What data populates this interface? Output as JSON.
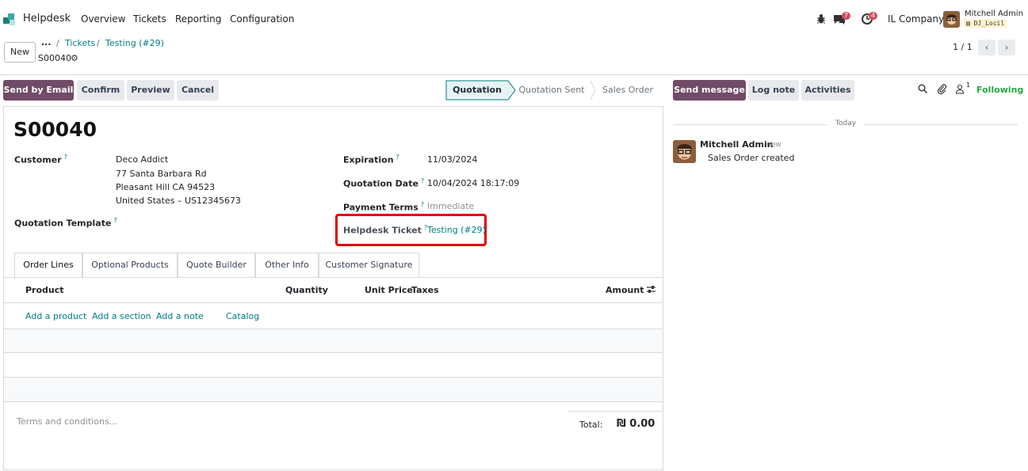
{
  "navbar": {
    "app_name": "Helpdesk",
    "menus": [
      "Overview",
      "Tickets",
      "Reporting",
      "Configuration"
    ],
    "messages_count": "7",
    "activities_count": "4",
    "company": "IL Company",
    "user_name": "Mitchell Admin",
    "database": "DJ_Locil"
  },
  "control_panel": {
    "new_label": "New",
    "breadcrumb_ellipsis": "...",
    "breadcrumb_items": [
      "Tickets",
      "Testing (#29)"
    ],
    "record_name": "S00040",
    "pager": "1 / 1"
  },
  "statusbar": {
    "buttons": [
      "Send by Email",
      "Confirm",
      "Preview",
      "Cancel"
    ],
    "stages": [
      "Quotation",
      "Quotation Sent",
      "Sales Order"
    ],
    "active_stage": "Quotation"
  },
  "form": {
    "title": "S00040",
    "customer_label": "Customer",
    "customer_lines": [
      "Deco Addict",
      "77 Santa Barbara Rd",
      "Pleasant Hill CA 94523",
      "United States – US12345673"
    ],
    "template_label": "Quotation Template",
    "expiration_label": "Expiration",
    "expiration_value": "11/03/2024",
    "quotation_date_label": "Quotation Date",
    "quotation_date_value": "10/04/2024 18:17:09",
    "payment_terms_label": "Payment Terms",
    "payment_terms_placeholder": "Immediate",
    "helpdesk_ticket_label": "Helpdesk Ticket",
    "helpdesk_ticket_value": "Testing (#29)",
    "help_marker": "?"
  },
  "tabs": [
    "Order Lines",
    "Optional Products",
    "Quote Builder",
    "Other Info",
    "Customer Signature"
  ],
  "order_lines": {
    "columns": {
      "product": "Product",
      "quantity": "Quantity",
      "unit_price": "Unit Price",
      "taxes": "Taxes",
      "amount": "Amount"
    },
    "actions": [
      "Add a product",
      "Add a section",
      "Add a note",
      "Catalog"
    ],
    "terms_placeholder": "Terms and conditions...",
    "total_label": "Total:",
    "total_value": "₪ 0.00"
  },
  "chatter": {
    "buttons": [
      "Send message",
      "Log note",
      "Activities"
    ],
    "followers_count": "1",
    "following_label": "Following",
    "date_separator": "Today",
    "message": {
      "author": "Mitchell Admin",
      "time": "- now",
      "body": "Sales Order created"
    }
  },
  "colors": {
    "brand": "#714b67",
    "link": "#017e84",
    "highlight": "#e00000",
    "following": "#28a745"
  }
}
